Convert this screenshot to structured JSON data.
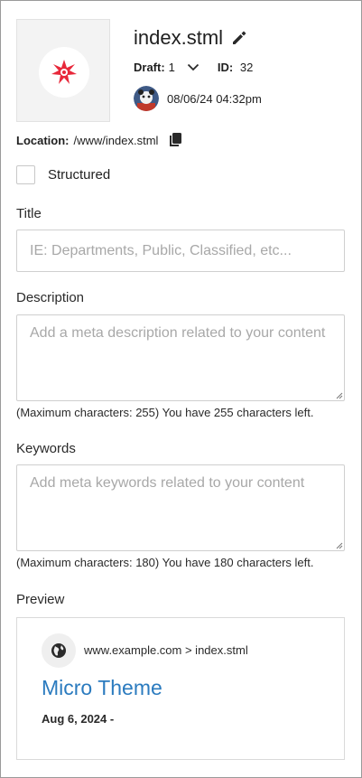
{
  "header": {
    "file_name": "index.stml",
    "draft_label": "Draft:",
    "draft_value": "1",
    "id_label": "ID:",
    "id_value": "32",
    "timestamp": "08/06/24 04:32pm"
  },
  "location": {
    "label": "Location:",
    "path": "/www/index.stml"
  },
  "structured": {
    "label": "Structured",
    "checked": false
  },
  "title_field": {
    "label": "Title",
    "value": "",
    "placeholder": "IE: Departments, Public, Classified, etc..."
  },
  "description_field": {
    "label": "Description",
    "value": "",
    "placeholder": "Add a meta description related to your content",
    "hint": "(Maximum characters: 255) You have 255 characters left."
  },
  "keywords_field": {
    "label": "Keywords",
    "value": "",
    "placeholder": "Add meta keywords related to your content",
    "hint": "(Maximum characters: 180) You have 180 characters left."
  },
  "preview": {
    "label": "Preview",
    "breadcrumb": "www.example.com > index.stml",
    "title": "Micro Theme",
    "date": "Aug 6, 2024 -"
  },
  "colors": {
    "accent_red": "#e8283a",
    "link_blue": "#2b7bbf"
  },
  "icons": [
    "starburst-logo-icon",
    "pencil-icon",
    "chevron-down-icon",
    "avatar-icon",
    "copy-icon",
    "globe-icon"
  ]
}
